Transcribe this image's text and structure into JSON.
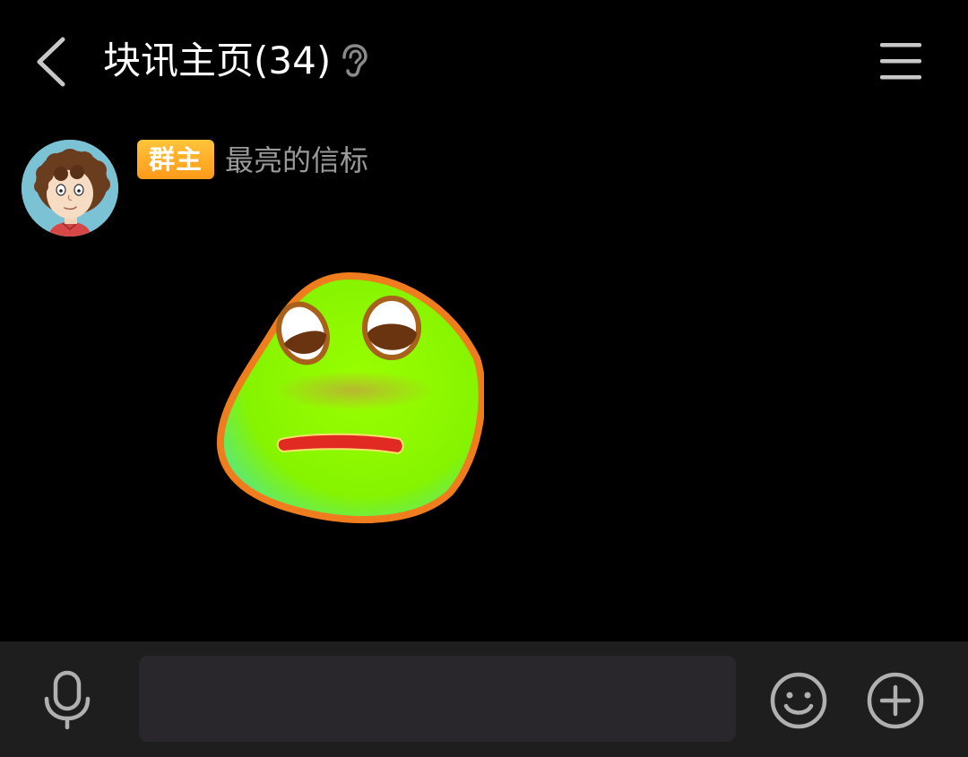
{
  "header": {
    "back_icon": "chevron-left-icon",
    "title": "块讯主页(34)",
    "ear_icon": "ear-icon",
    "menu_icon": "hamburger-menu-icon"
  },
  "message": {
    "role_badge": "群主",
    "sender_name": "最亮的信标",
    "avatar": "cartoon-avatar",
    "sticker": "green-blob-sad-face-sticker"
  },
  "input_bar": {
    "mic_icon": "microphone-icon",
    "input_value": "",
    "input_placeholder": "",
    "emoji_icon": "smiley-icon",
    "plus_icon": "plus-circle-icon"
  },
  "colors": {
    "background": "#000000",
    "bottom_bar": "#1e1e1e",
    "input_bg": "#2a272c",
    "badge_top": "#ffc43a",
    "badge_bottom": "#ff9a1a",
    "icon_gray": "#b0b0b0"
  }
}
